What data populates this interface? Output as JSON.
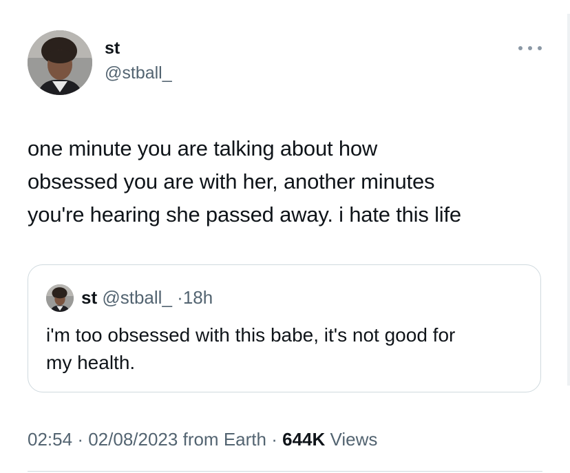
{
  "author": {
    "display_name": "st",
    "handle": "@stball_",
    "avatar_icon": "profile-photo"
  },
  "tweet": {
    "text_lines": [
      "one minute you are talking about how",
      "obsessed you are with her, another minutes",
      "you're hearing she passed away. i hate this life"
    ]
  },
  "quoted_tweet": {
    "display_name": "st",
    "handle": "@stball_",
    "separator": "·",
    "time": "18h",
    "text_lines": [
      "i'm too obsessed with this babe, it's not good for",
      "my health."
    ]
  },
  "meta": {
    "time": "02:54",
    "sep1": "·",
    "date": "02/08/2023",
    "source": "from Earth",
    "sep2": "·",
    "views_count": "644K",
    "views_label": "Views"
  },
  "colors": {
    "text_primary": "#0f1419",
    "text_secondary": "#536471",
    "border": "#cfd9de"
  }
}
